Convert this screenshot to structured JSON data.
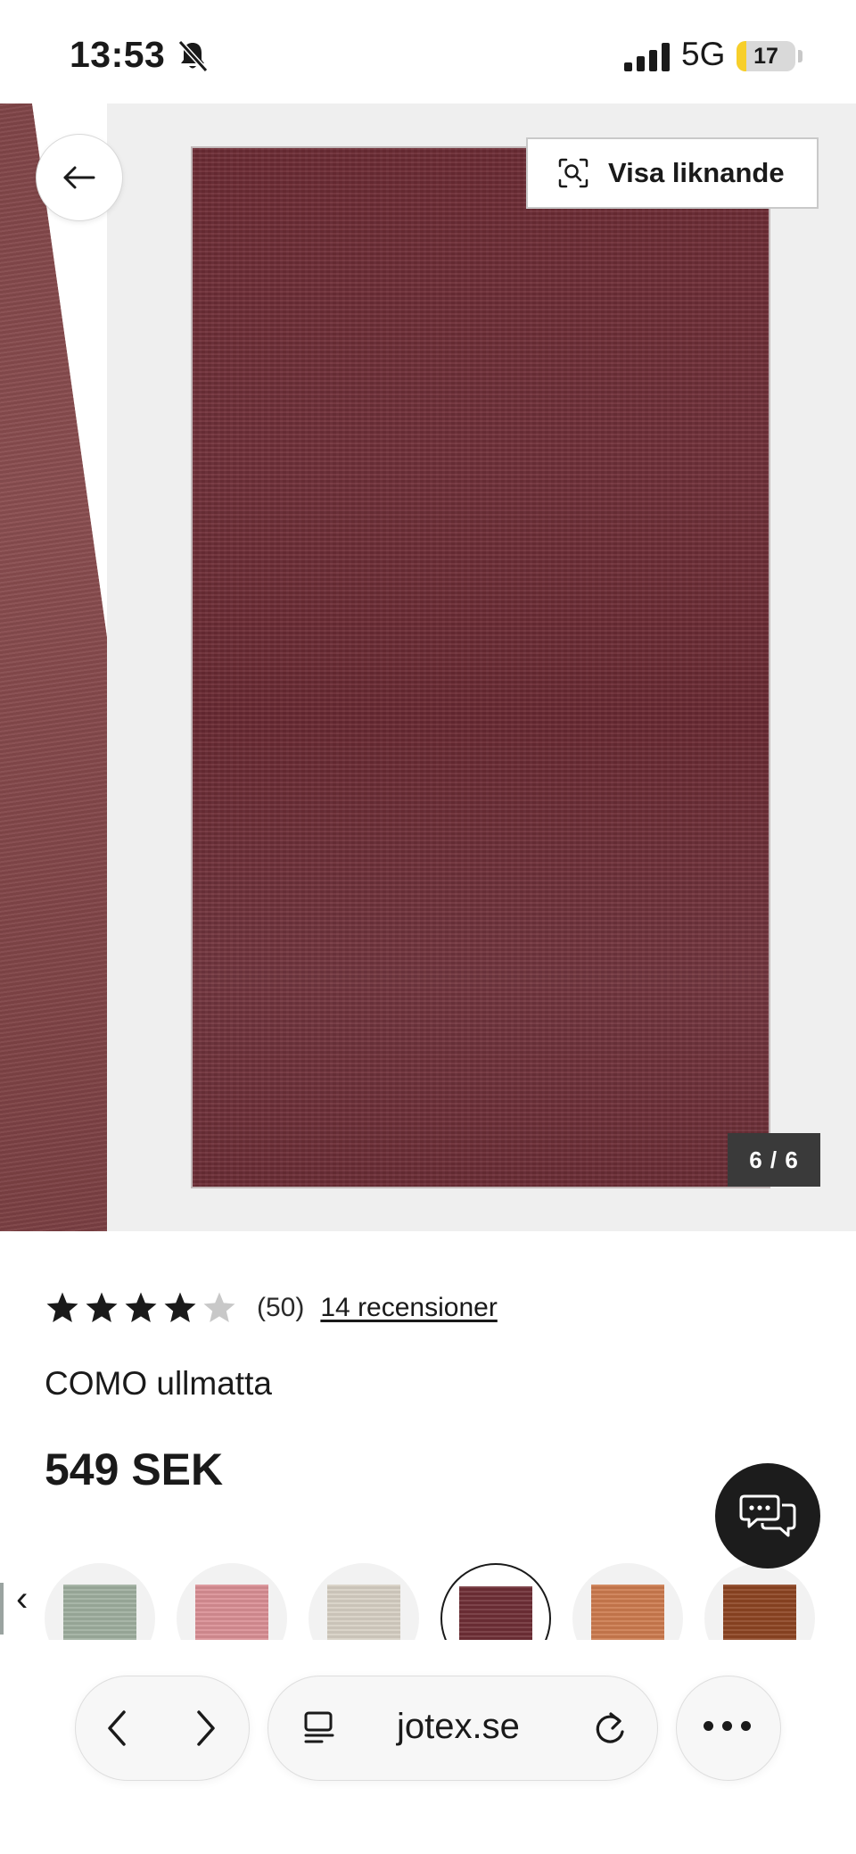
{
  "status_bar": {
    "time": "13:53",
    "network": "5G",
    "battery": "17",
    "battery_level": 0.17
  },
  "gallery": {
    "similar_label": "Visa liknande",
    "counter": "6 / 6",
    "rug_color": "#6d2c35"
  },
  "product": {
    "rating_stars": 4,
    "rating_max": 5,
    "rating_count": "(50)",
    "reviews_link": "14 recensioner",
    "title": "COMO ullmatta",
    "price": "549 SEK"
  },
  "swatches": [
    {
      "color": "#9eae9e",
      "selected": false
    },
    {
      "color": "#d98e94",
      "selected": false
    },
    {
      "color": "#d6cfc3",
      "selected": false
    },
    {
      "color": "#6e2f36",
      "selected": true
    },
    {
      "color": "#cc7a4e",
      "selected": false
    },
    {
      "color": "#8c4422",
      "selected": false
    }
  ],
  "browser": {
    "url": "jotex.se"
  },
  "colors": {
    "accent_dark": "#1c1c1c",
    "star_filled": "#1a1a1a",
    "star_empty": "#c8c8c8"
  }
}
